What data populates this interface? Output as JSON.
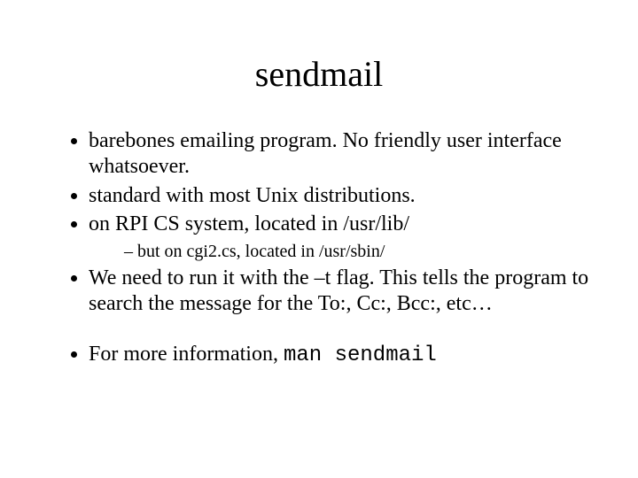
{
  "title": "sendmail",
  "bullets": {
    "b1": "barebones emailing program.  No friendly user interface whatsoever.",
    "b2": "standard with most Unix distributions.",
    "b3": "on RPI CS system, located in /usr/lib/",
    "b3sub": "but on cgi2.cs, located in /usr/sbin/",
    "b4": "We need to run it with the –t flag.  This tells the program to search the message for the To:, Cc:, Bcc:, etc…",
    "b5_prefix": "For more information, ",
    "b5_code": "man sendmail"
  }
}
